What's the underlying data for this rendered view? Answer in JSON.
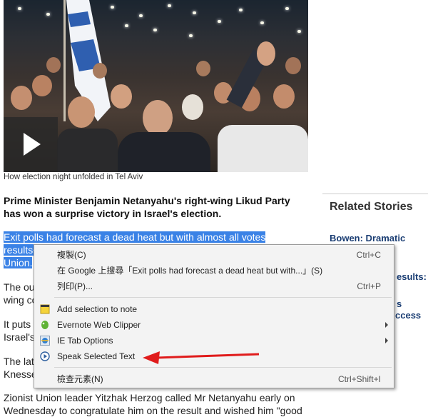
{
  "photo": {
    "caption": "How election night unfolded in Tel Aviv",
    "play_icon": "play-icon"
  },
  "article": {
    "headline": "Prime Minister Benjamin Netanyahu's right-wing Likud Party has won a surprise victory in Israel's election.",
    "sel_line1": "Exit polls had forecast a dead heat but with almost all votes counted,",
    "sel_line2_start": "results",
    "sel_line3_start": "Union.",
    "p2_start": "The ou",
    "p2_line2": "wing co",
    "p3_start": "It puts",
    "p3_line2": "Israel's",
    "p4_start": "The lat",
    "p4_line2": "Knesse",
    "p5_line1": "Zionist Union leader Yitzhak Herzog called Mr Netanyahu early on",
    "p5_line2": "Wednesday to congratulate him on the result and wished him \"good"
  },
  "related": {
    "title": "Related Stories",
    "link1": "Bowen: Dramatic",
    "link2_fragment": "esults:",
    "link3_fragment": "s",
    "link4_fragment": "ccess"
  },
  "context_menu": {
    "items": [
      {
        "label": "複製(C)",
        "shortcut": "Ctrl+C"
      },
      {
        "label": "在 Google 上搜尋「Exit polls had forecast a dead heat but with...」(S)",
        "shortcut": ""
      },
      {
        "label": "列印(P)...",
        "shortcut": "Ctrl+P"
      },
      {
        "label": "Add selection to note",
        "shortcut": "",
        "icon": "note-icon"
      },
      {
        "label": "Evernote Web Clipper",
        "shortcut": "",
        "icon": "evernote-icon",
        "submenu": true
      },
      {
        "label": "IE Tab Options",
        "shortcut": "",
        "icon": "ie-tab-icon",
        "submenu": true
      },
      {
        "label": "Speak Selected Text",
        "shortcut": "",
        "icon": "speak-icon"
      },
      {
        "label": "檢查元素(N)",
        "shortcut": "Ctrl+Shift+I"
      }
    ]
  },
  "colors": {
    "selection": "#3a82e6",
    "link": "#1a3d73",
    "annotation_arrow": "#e01b1b"
  }
}
